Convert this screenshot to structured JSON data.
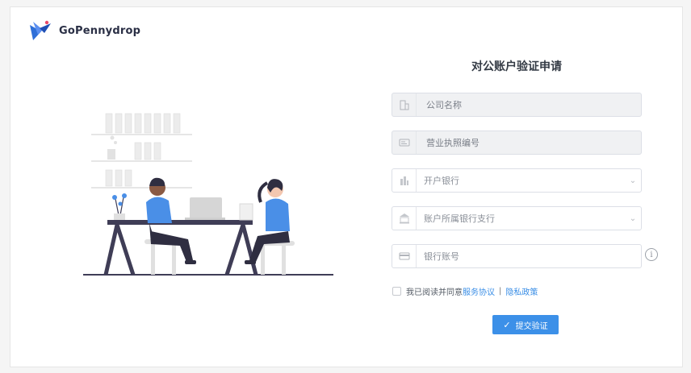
{
  "brand": {
    "name": "GoPennydrop"
  },
  "form": {
    "title": "对公账户验证申请",
    "company_name": {
      "placeholder": "公司名称",
      "icon": "building-icon"
    },
    "license_no": {
      "placeholder": "营业执照编号",
      "icon": "id-card-icon"
    },
    "bank": {
      "placeholder": "开户银行",
      "icon": "bank-building-icon"
    },
    "branch": {
      "placeholder": "账户所属银行支行",
      "icon": "bank-branch-icon"
    },
    "account_no": {
      "placeholder": "银行账号",
      "icon": "credit-card-icon"
    },
    "info_icon": "i",
    "agree": {
      "prefix": "我已阅读并同意",
      "terms": "服务协议",
      "separator": "|",
      "privacy": "隐私政策"
    },
    "submit_label": "提交验证"
  },
  "colors": {
    "accent": "#3c90e8",
    "link": "#3a8ee6",
    "figure_blue": "#4a8fe7"
  }
}
